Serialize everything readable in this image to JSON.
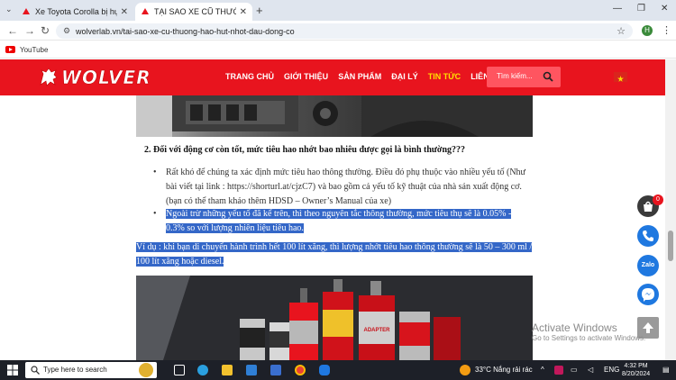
{
  "browser": {
    "tabs": [
      {
        "title": "Xe Toyota Corolla bị hụt nhớt m",
        "active": false
      },
      {
        "title": "TẠI SAO XE CŨ THƯỜNG HAO HỤT",
        "active": true
      }
    ],
    "url": "wolverlab.vn/tai-sao-xe-cu-thuong-hao-hut-nhot-dau-dong-co",
    "profile_initial": "H",
    "bookmarks": [
      {
        "label": "YouTube"
      }
    ]
  },
  "site": {
    "brand": "WOLVER",
    "nav": [
      {
        "label": "TRANG CHỦ",
        "active": false
      },
      {
        "label": "GIỚI THIỆU",
        "active": false
      },
      {
        "label": "SẢN PHẨM",
        "active": false
      },
      {
        "label": "ĐẠI LÝ",
        "active": false
      },
      {
        "label": "TIN TỨC",
        "active": true
      },
      {
        "label": "LIÊN HỆ",
        "active": false
      }
    ],
    "search_placeholder": "Tìm kiếm..."
  },
  "article": {
    "heading": "2. Đối với động cơ còn tốt, mức tiêu hao nhớt bao nhiêu được gọi là bình thường???",
    "bullet1": "Rất khó để chúng ta xác định mức tiêu hao thông thường. Điều đó phụ thuộc vào nhiều yếu tố (Như bài viết tại link : https://shorturl.at/cjzC7) và bao gồm cả yếu tố kỹ thuật của nhà sản xuất động cơ. (bạn có thể tham khảo thêm HDSD – Owner’s Manual của xe)",
    "bullet2": "Ngoài trừ những yếu tố đã kể trên, thì theo nguyên tắc thông thường, mức tiêu thụ sẽ là 0.05% - 0.3% so với lượng nhiên liệu tiêu hao.",
    "example": "Ví dụ : khi bạn di chuyển hành trình hết 100 lít xăng, thì lượng nhớt tiêu hao thông thường sẽ là 50 – 300 ml / 100 lít xăng hoặc diesel.",
    "product_label": "ADAPTER"
  },
  "widgets": {
    "cart_count": "0",
    "zalo_label": "Zalo"
  },
  "watermark": {
    "line1": "Activate Windows",
    "line2": "Go to Settings to activate Windows."
  },
  "taskbar": {
    "search_placeholder": "Type here to search",
    "weather": "33°C  Nắng rải rác",
    "lang": "ENG",
    "time": "4:32 PM",
    "date": "8/20/2024"
  },
  "colors": {
    "brand_red": "#e8141e",
    "nav_active": "#ffe000",
    "selection": "#3467c8"
  }
}
